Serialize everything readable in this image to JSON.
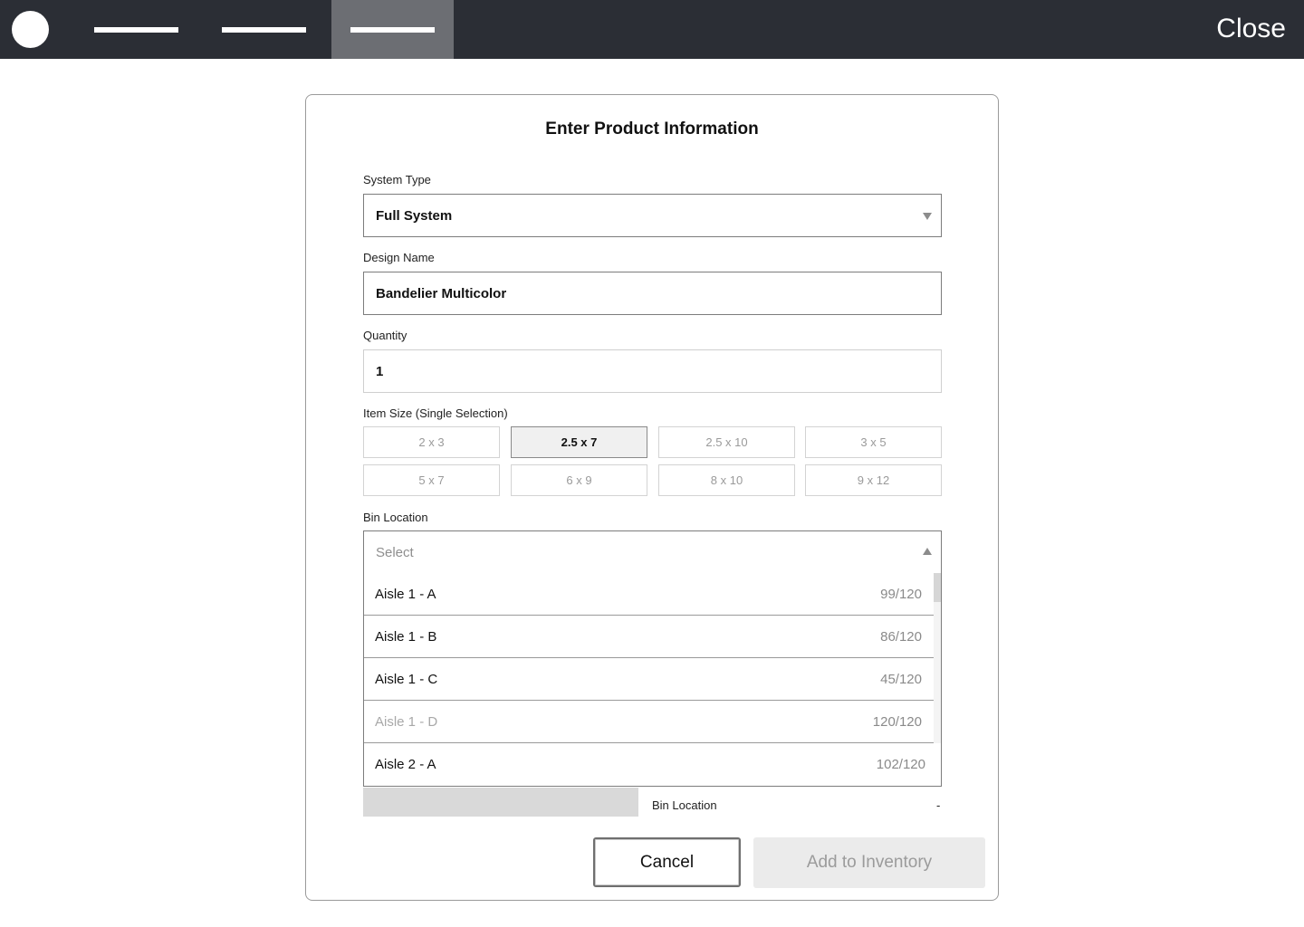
{
  "topbar": {
    "close_label": "Close"
  },
  "modal": {
    "title": "Enter Product Information",
    "system_type": {
      "label": "System Type",
      "value": "Full System"
    },
    "design_name": {
      "label": "Design Name",
      "value": "Bandelier Multicolor"
    },
    "quantity": {
      "label": "Quantity",
      "value": "1"
    },
    "item_size": {
      "label": "Item Size (Single Selection)",
      "selected": "2.5 x 7",
      "options": [
        "2 x 3",
        "2.5 x 7",
        "2.5 x 10",
        "3 x 5",
        "5 x 7",
        "6 x 9",
        "8 x 10",
        "9 x 12"
      ]
    },
    "bin_location": {
      "label": "Bin Location",
      "placeholder": "Select",
      "options": [
        {
          "name": "Aisle 1 - A",
          "count": "99/120",
          "disabled": false
        },
        {
          "name": "Aisle 1 - B",
          "count": "86/120",
          "disabled": false
        },
        {
          "name": "Aisle 1 - C",
          "count": "45/120",
          "disabled": false
        },
        {
          "name": "Aisle 1 - D",
          "count": "120/120",
          "disabled": true
        },
        {
          "name": "Aisle 2 - A",
          "count": "102/120",
          "disabled": false
        }
      ]
    },
    "summary": {
      "label": "Bin Location",
      "value": "-"
    },
    "buttons": {
      "cancel": "Cancel",
      "add": "Add to Inventory"
    }
  }
}
